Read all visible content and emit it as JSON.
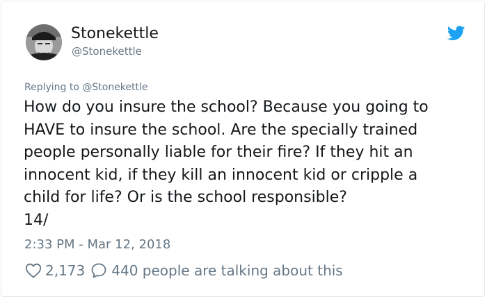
{
  "tweet": {
    "author": {
      "display_name": "Stonekettle",
      "handle": "@Stonekettle",
      "avatar_icon": "avatar-photo"
    },
    "platform_icon": "twitter-bird-icon",
    "brand_color": "#1da1f2",
    "replying_to": "Replying to @Stonekettle",
    "text_lines": [
      "How do you insure the school? Because you going to",
      "HAVE to insure the school. Are the specially trained",
      "people personally liable for their fire? If they hit an",
      "innocent kid, if they kill an innocent kid or cripple a",
      "child for life? Or is the school responsible?",
      "14/"
    ],
    "timestamp": "2:33 PM - Mar 12, 2018",
    "likes": "2,173",
    "replies_text": "440 people are talking about this"
  }
}
